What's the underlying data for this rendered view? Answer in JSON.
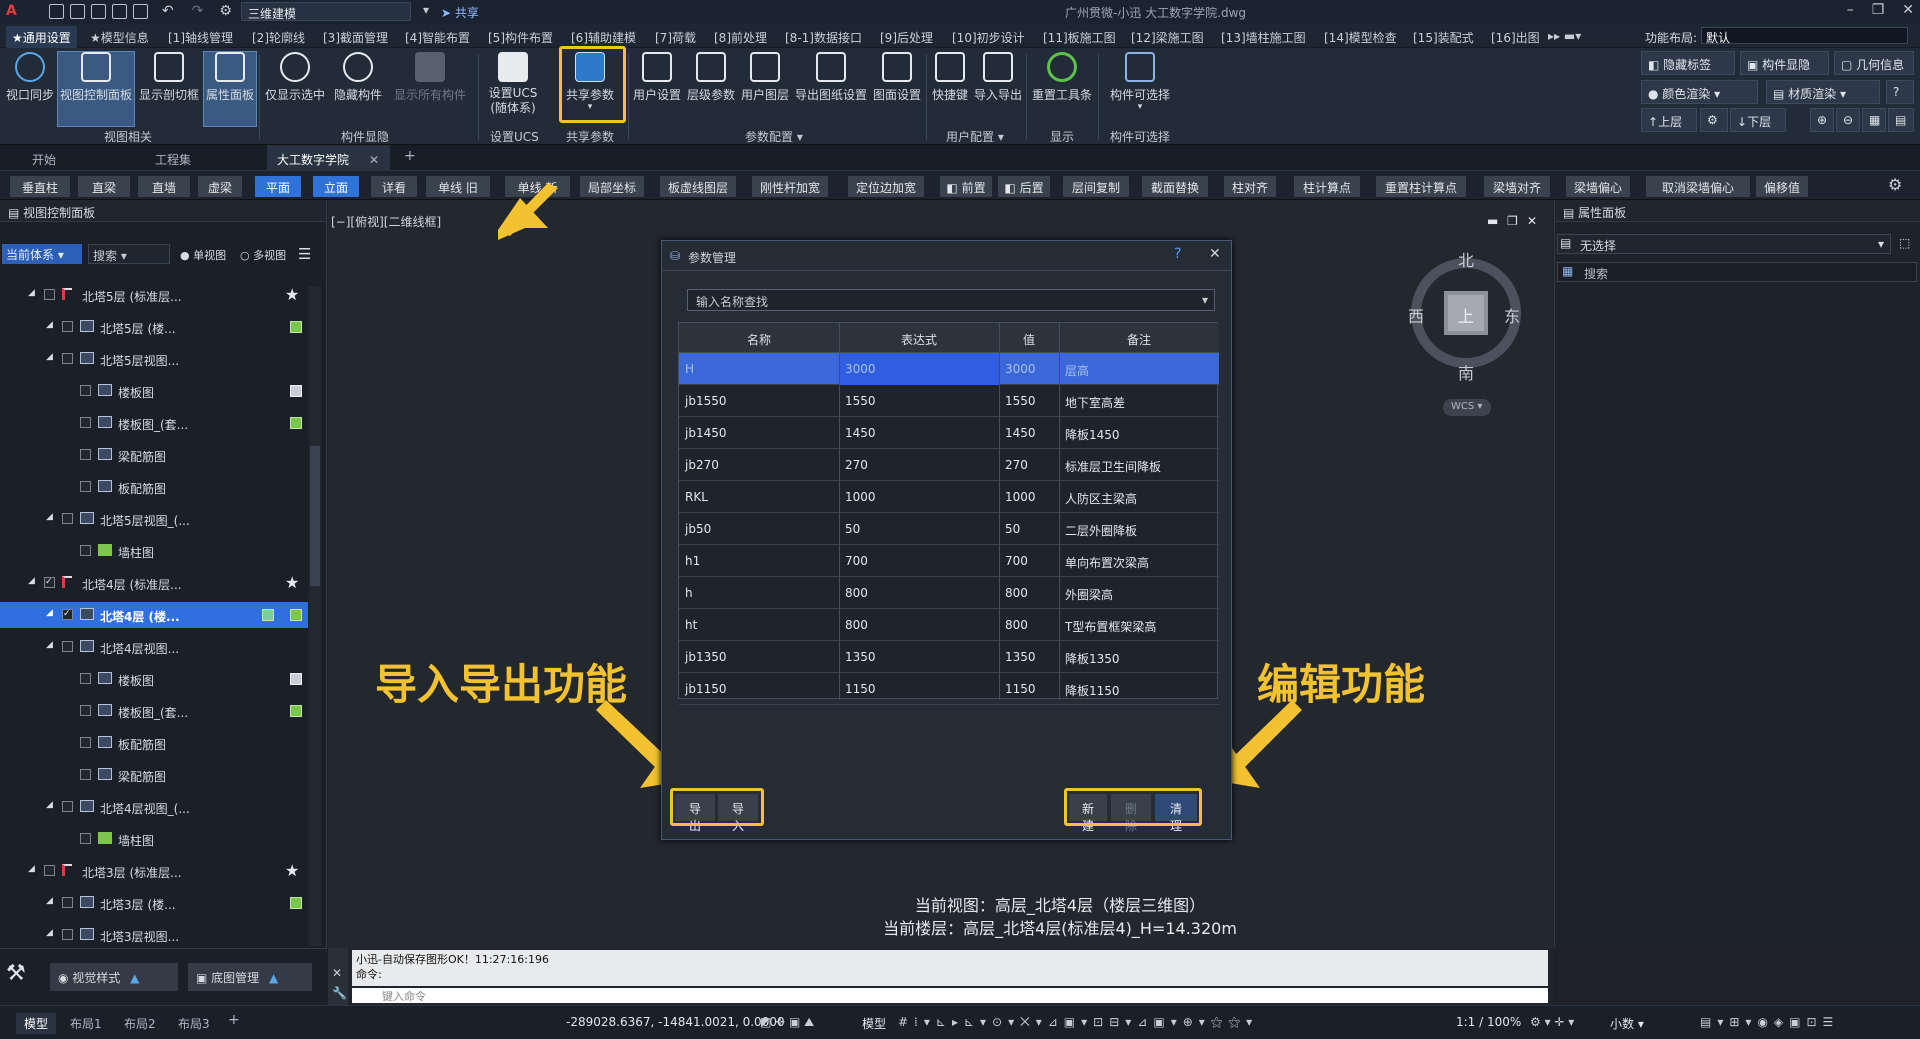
{
  "titlebar": {
    "workspace": "三维建模",
    "share": "共享",
    "title": "广州贯微-小迅    大工数字学院.dwg"
  },
  "menubar": {
    "tabs": [
      "★通用设置",
      "★模型信息",
      "[1]轴线管理",
      "[2]轮廓线",
      "[3]截面管理",
      "[4]智能布置",
      "[5]构件布置",
      "[6]辅助建模",
      "[7]荷载",
      "[8]前处理",
      "[8-1]数据接口",
      "[9]后处理",
      "[10]初步设计",
      "[11]板施工图",
      "[12]梁施工图",
      "[13]墙柱施工图",
      "[14]模型检查",
      "[15]装配式",
      "[16]出图"
    ],
    "layout_label": "功能布局:",
    "layout_value": "默认"
  },
  "ribbon": {
    "buttons": [
      "视口同步",
      "视图控制面板",
      "显示剖切框",
      "属性面板",
      "仅显示选中",
      "隐藏构件",
      "显示所有构件",
      "设置UCS\n(随体系)",
      "共享参数",
      "用户设置",
      "层级参数",
      "用户图层",
      "导出图纸设置",
      "图面设置",
      "快捷键",
      "导入导出",
      "重置工具条",
      "构件可选择"
    ],
    "groups": [
      "视图相关",
      "构件显隐",
      "设置UCS",
      "共享参数",
      "参数配置",
      "用户配置",
      "显示",
      "构件可选择"
    ],
    "right": [
      "隐藏标签",
      "构件显隐",
      "几何信息",
      "颜色渲染",
      "材质渲染",
      "上层",
      "下层"
    ]
  },
  "doctabs": [
    "开始",
    "工程集",
    "大工数字学院"
  ],
  "toolbar2": [
    "垂直柱",
    "直梁",
    "直墙",
    "虚梁",
    "平面",
    "立面",
    "详看",
    "单线 旧",
    "单线 新",
    "局部坐标",
    "板虚线图层",
    "刚性杆加宽",
    "定位边加宽",
    "前置",
    "后置",
    "层间复制",
    "截面替换",
    "柱对齐",
    "柱计算点",
    "重置柱计算点",
    "梁墙对齐",
    "梁墙偏心",
    "取消梁墙偏心",
    "偏移值"
  ],
  "leftpanel": {
    "title": "视图控制面板",
    "system": "当前体系",
    "search": "搜索",
    "single": "单视图",
    "multi": "多视图",
    "rows": [
      "北塔5层  (标准层...",
      "北塔5层  (楼...",
      "北塔5层视图...",
      "楼板图",
      "楼板图_(套...",
      "梁配筋图",
      "板配筋图",
      "北塔5层视图_(...",
      "墙柱图",
      "北塔4层  (标准层...",
      "北塔4层  (楼...",
      "北塔4层视图...",
      "楼板图",
      "楼板图_(套...",
      "板配筋图",
      "梁配筋图",
      "北塔4层视图_(...",
      "墙柱图",
      "北塔3层  (标准层...",
      "北塔3层  (楼...",
      "北塔3层视图..."
    ]
  },
  "bottom": {
    "view_style": "视觉样式",
    "base_map": "底图管理"
  },
  "viewport": {
    "label": "[−][俯视][二维线框]",
    "compass": {
      "n": "北",
      "s": "南",
      "e": "东",
      "w": "西",
      "center": "上",
      "wcs": "WCS"
    },
    "current_view": "当前视图：高层_北塔4层（楼层三维图）",
    "current_floor": "当前楼层：高层_北塔4层(标准层4)_H=14.320m",
    "callout_left": "导入导出功能",
    "callout_right": "编辑功能"
  },
  "dialog": {
    "title": "参数管理",
    "search_placeholder": "输入名称查找",
    "columns": [
      "名称",
      "表达式",
      "值",
      "备注"
    ],
    "rows": [
      [
        "H",
        "3000",
        "3000",
        "层高"
      ],
      [
        "jb1550",
        "1550",
        "1550",
        "地下室高差"
      ],
      [
        "jb1450",
        "1450",
        "1450",
        "降板1450"
      ],
      [
        "jb270",
        "270",
        "270",
        "标准层卫生间降板"
      ],
      [
        "RKL",
        "1000",
        "1000",
        "人防区主梁高"
      ],
      [
        "jb50",
        "50",
        "50",
        "二层外圈降板"
      ],
      [
        "h1",
        "700",
        "700",
        "单向布置次梁高"
      ],
      [
        "h",
        "800",
        "800",
        "外圈梁高"
      ],
      [
        "ht",
        "800",
        "800",
        "T型布置框架梁高"
      ],
      [
        "jb1350",
        "1350",
        "1350",
        "降板1350"
      ],
      [
        "jb1150",
        "1150",
        "1150",
        "降板1150"
      ]
    ],
    "buttons": {
      "export": "导出",
      "import": "导入",
      "new": "新建",
      "delete": "删除",
      "clear": "清理"
    }
  },
  "rightpanel": {
    "title": "属性面板",
    "selection": "无选择",
    "search": "搜索"
  },
  "command": {
    "line1": "小迅-自动保存图形OK！11:27:16:196",
    "line2": "命令:",
    "placeholder": "键入命令"
  },
  "statusbar": {
    "tabs": [
      "模型",
      "布局1",
      "布局2",
      "布局3"
    ],
    "coords": "-289028.6367, -14841.0021, 0.0000",
    "model": "模型",
    "scale": "1:1 / 100%",
    "decimal": "小数"
  }
}
